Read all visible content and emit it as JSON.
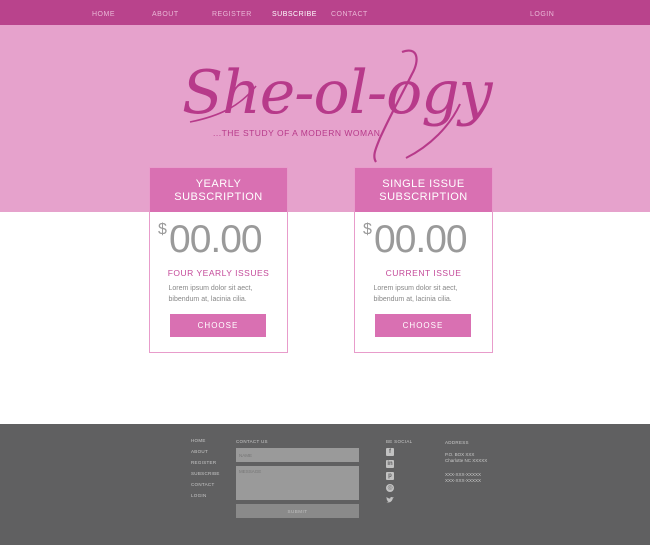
{
  "nav": {
    "items": [
      "HOME",
      "ABOUT",
      "REGISTER",
      "SUBSCRIBE",
      "CONTACT"
    ],
    "login": "LOGIN",
    "active": "SUBSCRIBE"
  },
  "hero": {
    "logo_text": "She-ol-ogy",
    "tagline": "...THE STUDY OF A MODERN WOMAN"
  },
  "cards": [
    {
      "title_line1": "YEARLY",
      "title_line2": "SUBSCRIPTION",
      "currency": "$",
      "amount": "00.00",
      "subtitle": "FOUR YEARLY ISSUES",
      "text": "Lorem ipsum dolor sit aect, bibendum at, lacinia cilia.",
      "button": "CHOOSE"
    },
    {
      "title_line1": "SINGLE ISSUE",
      "title_line2": "SUBSCRIPTION",
      "currency": "$",
      "amount": "00.00",
      "subtitle": "CURRENT ISSUE",
      "text": "Lorem ipsum dolor sit aect, bibendum at, lacinia cilia.",
      "button": "CHOOSE"
    }
  ],
  "footer": {
    "links": [
      "HOME",
      "ABOUT",
      "REGISTER",
      "SUBSCRIBE",
      "CONTACT",
      "LOGIN"
    ],
    "contact_label": "CONTACT US",
    "name_placeholder": "NAME",
    "message_placeholder": "MESSAGE",
    "submit": "SUBMIT",
    "social_label": "BE SOCIAL",
    "social_icons": [
      "facebook-icon",
      "linkedin-icon",
      "pinterest-icon",
      "instagram-icon",
      "twitter-icon"
    ],
    "address_label": "ADDRESS",
    "address_line1": "P.O. BOX XXX",
    "address_line2": "Charlotte NC XXXXX",
    "phone_1": "XXX-XXX-XXXXX",
    "phone_2": "XXX-XXX-XXXXX"
  },
  "colors": {
    "nav": "#b9438c",
    "hero": "#e6a2cc",
    "accent": "#d970b2",
    "footer": "#606061"
  }
}
